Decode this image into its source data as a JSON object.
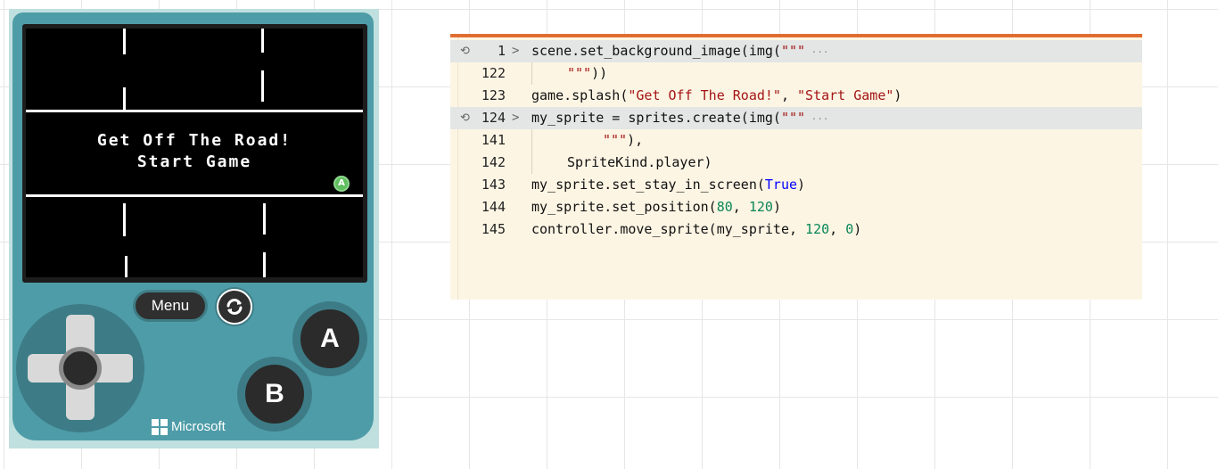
{
  "simulator": {
    "splash": {
      "title": "Get Off The Road!",
      "subtitle": "Start Game"
    },
    "a_badge": "A",
    "menu_label": "Menu",
    "buttons": {
      "a": "A",
      "b": "B"
    },
    "brand": "Microsoft"
  },
  "editor": {
    "accent_color": "#e06d32",
    "lines": [
      {
        "num": "1",
        "collapsed": true,
        "code": "scene.set_background_image(img(\"\"\""
      },
      {
        "num": "122",
        "code": "\"\"\"))"
      },
      {
        "num": "123",
        "code": "game.splash(\"Get Off The Road!\", \"Start Game\")"
      },
      {
        "num": "124",
        "collapsed": true,
        "code": "my_sprite = sprites.create(img(\"\"\""
      },
      {
        "num": "141",
        "code": "\"\"\"),"
      },
      {
        "num": "142",
        "code": "SpriteKind.player)"
      },
      {
        "num": "143",
        "code": "my_sprite.set_stay_in_screen(True)"
      },
      {
        "num": "144",
        "code": "my_sprite.set_position(80, 120)"
      },
      {
        "num": "145",
        "code": "controller.move_sprite(my_sprite, 120, 0)"
      }
    ]
  }
}
